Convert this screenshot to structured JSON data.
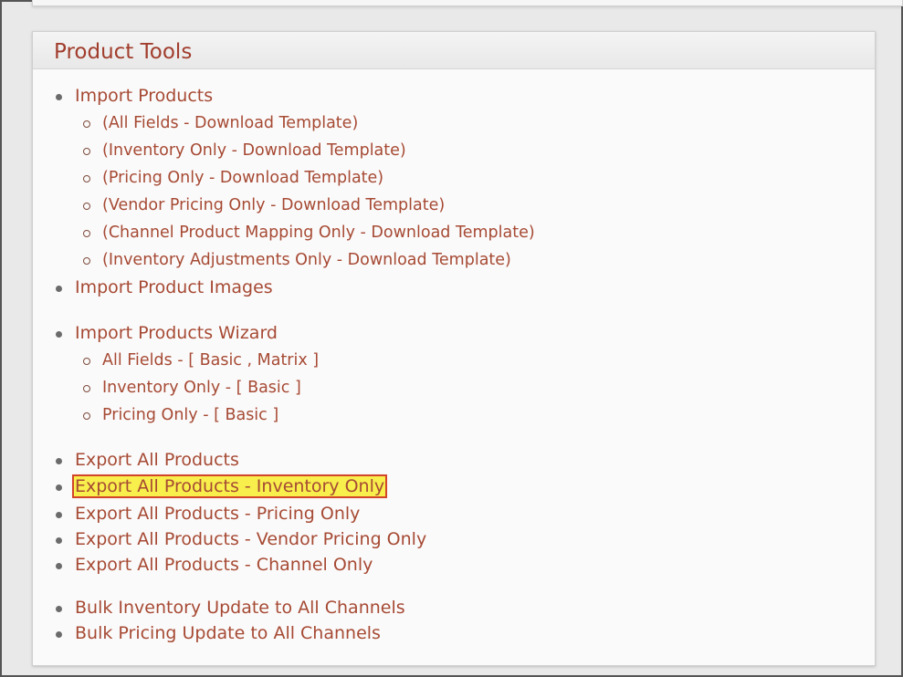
{
  "panel": {
    "title": "Product Tools"
  },
  "items": {
    "import_products": "Import Products",
    "import_sub": [
      "(All Fields - Download Template)",
      "(Inventory Only - Download Template)",
      "(Pricing Only - Download Template)",
      "(Vendor Pricing Only - Download Template)",
      "(Channel Product Mapping Only - Download Template)",
      "(Inventory Adjustments Only - Download Template)"
    ],
    "import_product_images": "Import Product Images",
    "import_products_wizard": "Import Products Wizard",
    "wizard_sub": [
      "All Fields - [ Basic , Matrix ]",
      "Inventory Only - [ Basic ]",
      "Pricing Only - [ Basic ]"
    ],
    "export": [
      "Export All Products",
      "Export All Products - Inventory Only",
      "Export All Products - Pricing Only",
      "Export All Products - Vendor Pricing Only",
      "Export All Products - Channel Only"
    ],
    "bulk": [
      "Bulk Inventory Update to All Channels",
      "Bulk Pricing Update to All Channels"
    ]
  },
  "highlight_color": "#f8ee4c",
  "highlight_border": "#d2452a",
  "link_color": "#a64a34"
}
